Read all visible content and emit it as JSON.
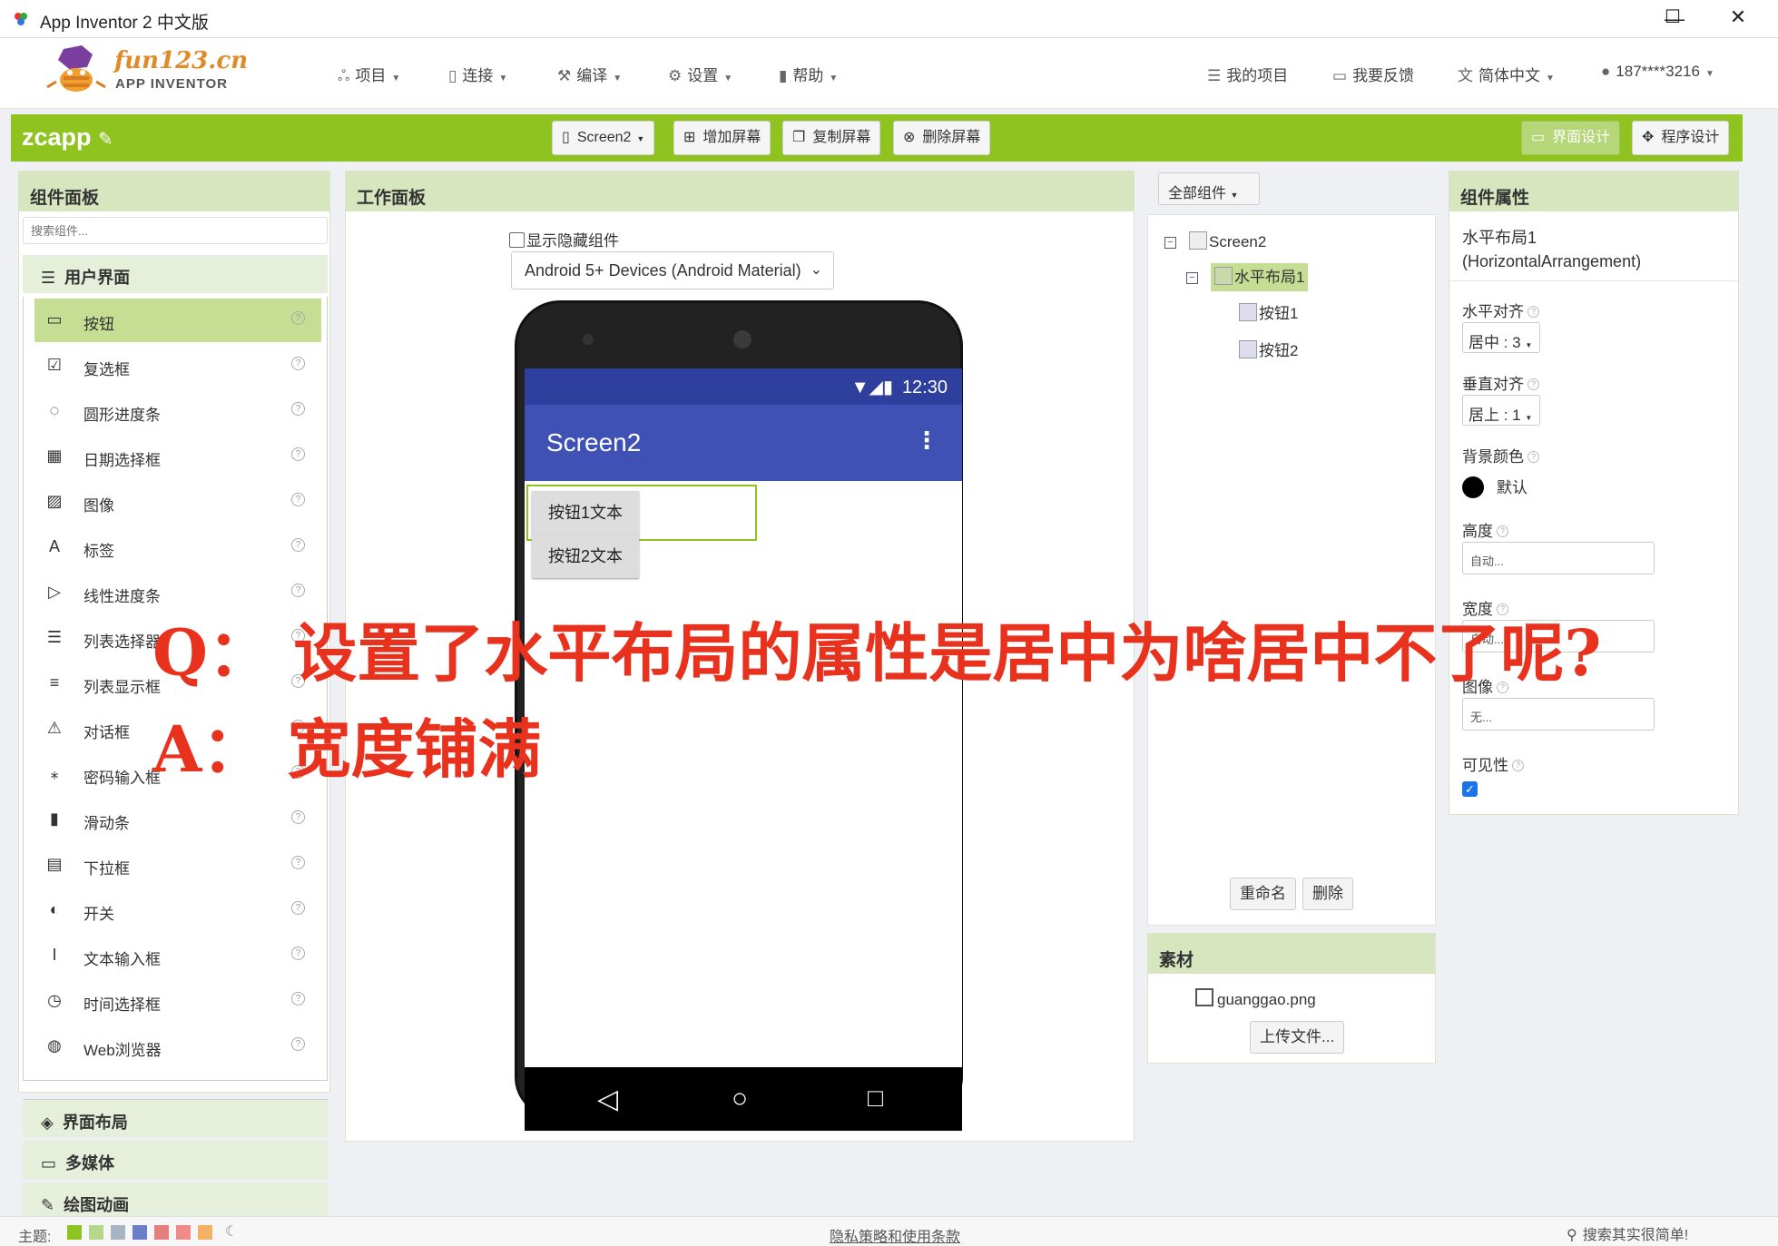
{
  "window": {
    "title": "App Inventor 2 中文版",
    "min": "—",
    "max": "☐",
    "close": "✕"
  },
  "logo": {
    "brand": "fun123.cn",
    "sub": "APP INVENTOR"
  },
  "nav": {
    "project": "项目",
    "connect": "连接",
    "build": "编译",
    "settings": "设置",
    "help": "帮助",
    "my_projects": "我的项目",
    "feedback": "我要反馈",
    "language": "简体中文",
    "user": "187****3216"
  },
  "toolbar": {
    "project_name": "zcapp",
    "screen": "Screen2",
    "add_screen": "增加屏幕",
    "copy_screen": "复制屏幕",
    "remove_screen": "删除屏幕",
    "designer": "界面设计",
    "blocks": "程序设计"
  },
  "palette": {
    "title": "组件面板",
    "search_placeholder": "搜索组件...",
    "category_ui": "用户界面",
    "items": [
      "按钮",
      "复选框",
      "圆形进度条",
      "日期选择框",
      "图像",
      "标签",
      "线性进度条",
      "列表选择器",
      "列表显示框",
      "对话框",
      "密码输入框",
      "滑动条",
      "下拉框",
      "开关",
      "文本输入框",
      "时间选择框",
      "Web浏览器"
    ],
    "category_layout": "界面布局",
    "category_media": "多媒体",
    "category_drawing": "绘图动画"
  },
  "viewer": {
    "title": "工作面板",
    "show_hidden": "显示隐藏组件",
    "device": "Android 5+ Devices (Android Material)",
    "status_time": "12:30",
    "status_icons": "▼◢▮",
    "screen_title": "Screen2",
    "button1": "按钮1文本",
    "button2": "按钮2文本"
  },
  "components": {
    "filter": "全部组件",
    "tree": [
      "Screen2",
      "水平布局1",
      "按钮1",
      "按钮2"
    ],
    "rename": "重命名",
    "delete": "删除"
  },
  "assets": {
    "title": "素材",
    "file": "guanggao.png",
    "upload": "上传文件..."
  },
  "properties": {
    "title": "组件属性",
    "component_name": "水平布局1",
    "component_type": "(HorizontalArrangement)",
    "h_align_label": "水平对齐",
    "h_align_value": "居中 : 3",
    "v_align_label": "垂直对齐",
    "v_align_value": "居上 : 1",
    "bg_label": "背景颜色",
    "bg_value": "默认",
    "height_label": "高度",
    "height_value": "自动...",
    "width_label": "宽度",
    "width_value": "自动...",
    "image_label": "图像",
    "image_value": "无...",
    "visible_label": "可见性",
    "visible_checked": true
  },
  "footer": {
    "theme": "主题:",
    "privacy": "隐私策略和使用条款",
    "search": "搜索其实很简单!",
    "theme_colors": [
      "#8fc31f",
      "#b5d88a",
      "#a9b4c2",
      "#6b7fc8",
      "#e57f7f",
      "#f28a8a",
      "#f5b163"
    ]
  },
  "overlay": {
    "q": "Q：  设置了水平布局的属性是居中为啥居中不了呢?",
    "a": "A：  宽度铺满"
  },
  "colors": {
    "accent": "#8fc31f",
    "appbar": "#3f51b5",
    "overlay": "#e8321e"
  }
}
